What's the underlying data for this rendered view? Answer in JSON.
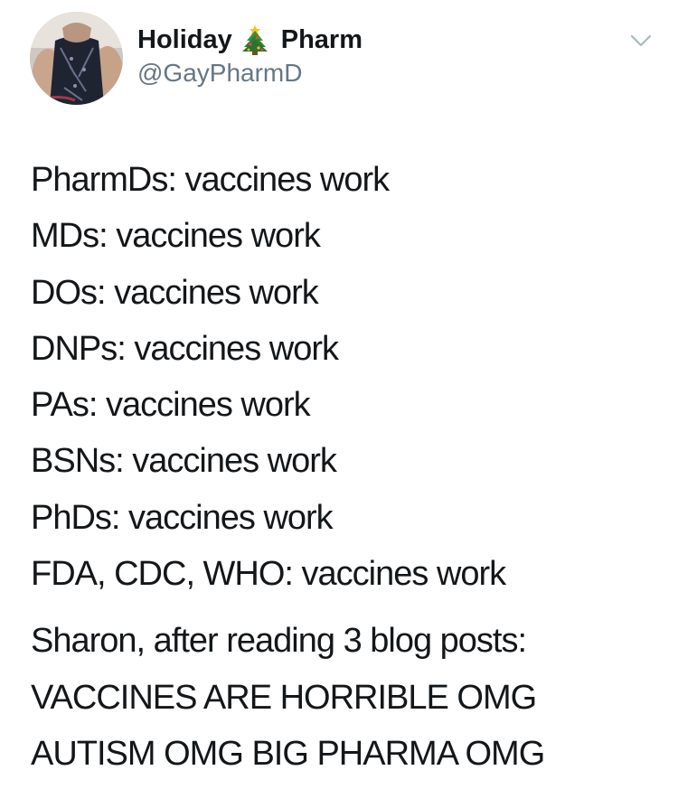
{
  "author": {
    "name_part1": "Holiday",
    "name_icon": "christmas-tree-icon",
    "name_part2": "Pharm",
    "handle": "@GayPharmD",
    "avatar_icon": "avatar-photo"
  },
  "menu": {
    "icon": "chevron-down-icon"
  },
  "tweet": {
    "lines": [
      "PharmDs: vaccines work",
      "MDs: vaccines work",
      "DOs: vaccines work",
      "DNPs: vaccines work",
      "PAs: vaccines work",
      "BSNs: vaccines work",
      "PhDs: vaccines work",
      "FDA, CDC, WHO: vaccines work"
    ],
    "closing_lines": [
      "Sharon, after reading 3 blog posts:",
      "VACCINES ARE HORRIBLE OMG",
      "AUTISM OMG BIG PHARMA OMG"
    ]
  },
  "colors": {
    "text": "#14171a",
    "handle": "#657786",
    "caret": "#aab8c2"
  }
}
